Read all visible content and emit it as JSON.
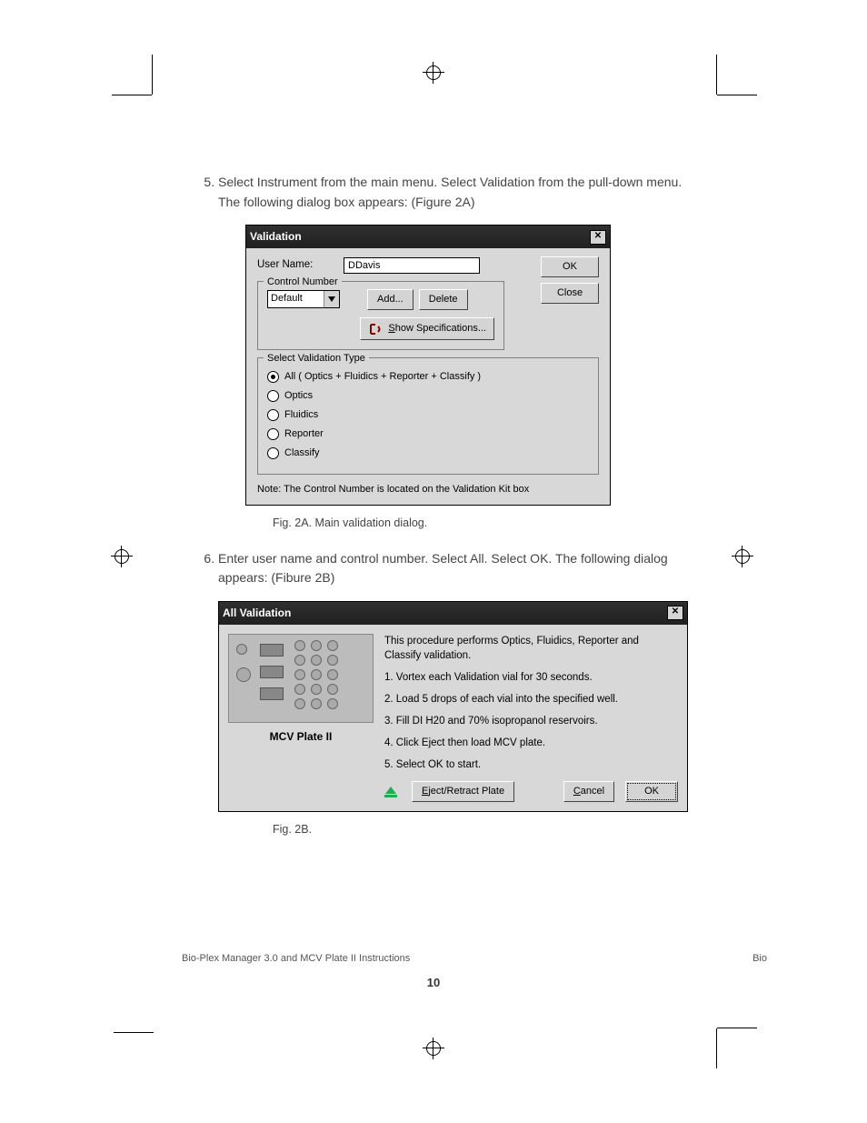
{
  "step5": {
    "num": "5",
    "text": "Select Instrument from the main menu. Select Validation from the pull-down menu. The following dialog box appears: (Figure 2A)"
  },
  "step6": {
    "num": "6",
    "text": "Enter user name and control number. Select All. Select OK. The following dialog appears: (Fibure 2B)"
  },
  "fig2a_caption": "Fig. 2A. Main validation dialog.",
  "fig2b_caption": "Fig. 2B.",
  "dialog1": {
    "title": "Validation",
    "user_label": "User Name:",
    "user_value": "DDavis",
    "ok": "OK",
    "close": "Close",
    "control_legend": "Control Number",
    "control_value": "Default",
    "add": "Add...",
    "delete": "Delete",
    "show_spec": "Show Specifications...",
    "validation_legend": "Select Validation Type",
    "radios": {
      "all": "All  ( Optics + Fluidics + Reporter + Classify )",
      "optics": "Optics",
      "fluidics": "Fluidics",
      "reporter": "Reporter",
      "classify": "Classify"
    },
    "note": "Note: The Control Number is located on the Validation Kit box"
  },
  "dialog2": {
    "title": "All Validation",
    "plate_label": "MCV Plate II",
    "intro": "This procedure performs Optics, Fluidics, Reporter and Classify validation.",
    "s1": "1. Vortex each Validation vial for 30 seconds.",
    "s2": "2. Load 5 drops of each vial into the specified well.",
    "s3": "3. Fill DI H20 and 70% isopropanol reservoirs.",
    "s4": "4. Click Eject then load MCV plate.",
    "s5": "5. Select OK to start.",
    "eject": "Eject/Retract Plate",
    "cancel": "Cancel",
    "ok": "OK"
  },
  "footer": "Bio-Plex Manager 3.0 and MCV Plate II Instructions",
  "footer_right": "Bio",
  "pagenum": "10"
}
